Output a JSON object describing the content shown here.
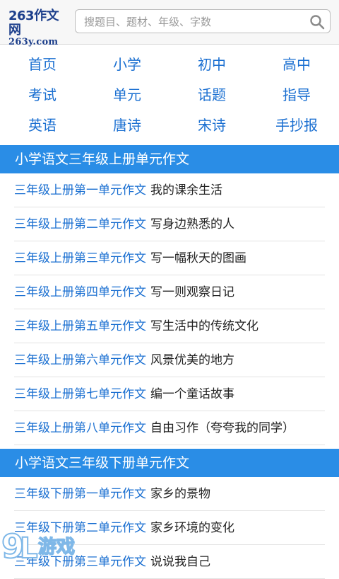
{
  "header": {
    "logo_top": "263作文网",
    "logo_bottom": "263y.com",
    "search_placeholder": "搜题目、题材、年级、字数"
  },
  "nav": [
    [
      "首页",
      "小学",
      "初中",
      "高中"
    ],
    [
      "考试",
      "单元",
      "话题",
      "指导"
    ],
    [
      "英语",
      "唐诗",
      "宋诗",
      "手抄报"
    ]
  ],
  "sections": [
    {
      "title": "小学语文三年级上册单元作文",
      "items": [
        {
          "link": "三年级上册第一单元作文",
          "topic": "我的课余生活"
        },
        {
          "link": "三年级上册第二单元作文",
          "topic": "写身边熟悉的人"
        },
        {
          "link": "三年级上册第三单元作文",
          "topic": "写一幅秋天的图画"
        },
        {
          "link": "三年级上册第四单元作文",
          "topic": "写一则观察日记"
        },
        {
          "link": "三年级上册第五单元作文",
          "topic": "写生活中的传统文化"
        },
        {
          "link": "三年级上册第六单元作文",
          "topic": "风景优美的地方"
        },
        {
          "link": "三年级上册第七单元作文",
          "topic": "编一个童话故事"
        },
        {
          "link": "三年级上册第八单元作文",
          "topic": "自由习作（夸夸我的同学）"
        }
      ]
    },
    {
      "title": "小学语文三年级下册单元作文",
      "items": [
        {
          "link": "三年级下册第一单元作文",
          "topic": "家乡的景物"
        },
        {
          "link": "三年级下册第二单元作文",
          "topic": "家乡环境的变化"
        },
        {
          "link": "三年级下册第三单元作文",
          "topic": "说说我自己"
        }
      ]
    }
  ],
  "watermark": {
    "text": "游戏"
  },
  "colors": {
    "accent": "#2a8de6",
    "link": "#1a6fd1",
    "logo": "#1d3f8c"
  }
}
